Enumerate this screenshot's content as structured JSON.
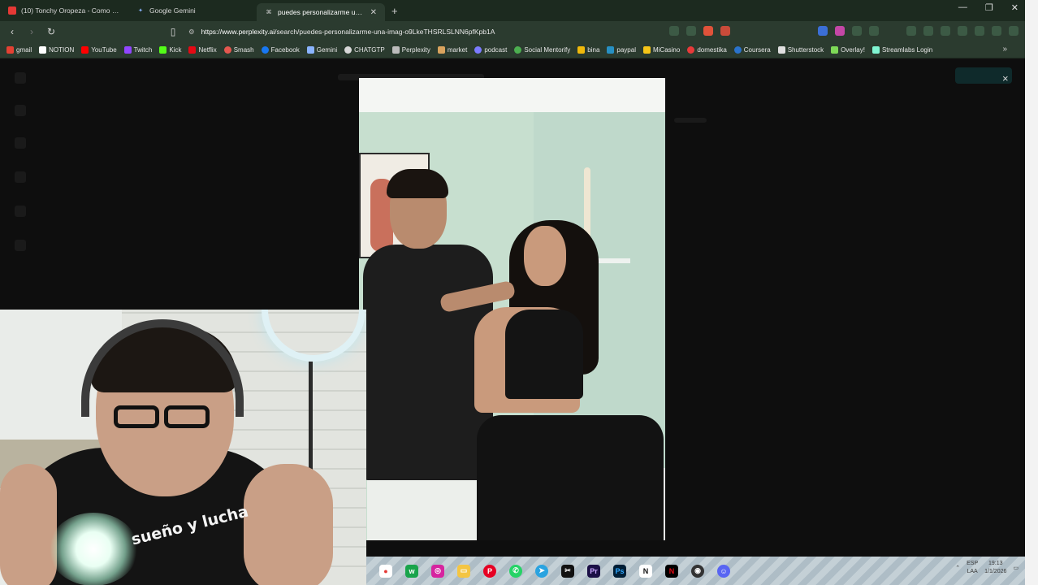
{
  "browser": {
    "tabs": [
      {
        "label": "(10) Tonchy Oropeza - Como cal...",
        "icon": "youtube-icon",
        "active": false
      },
      {
        "label": "Google Gemini",
        "icon": "gemini-icon",
        "active": false
      },
      {
        "label": "puedes personalizarme una imag...",
        "icon": "perplexity-icon",
        "active": true
      }
    ],
    "url": {
      "host": "https://www.perplexity.ai",
      "path": "/search/puedes-personalizarme-una-imag-o9LkeTHSRLSLNN6pfKpb1A"
    },
    "bookmarks": [
      "gmail",
      "NOTION",
      "YouTube",
      "Twitch",
      "Kick",
      "Netflix",
      "Smash",
      "Facebook",
      "Gemini",
      "CHATGTP",
      "Perplexity",
      "market",
      "podcast",
      "Social Mentorify",
      "bina",
      "paypal",
      "MiCasino",
      "domestika",
      "Coursera",
      "Shutterstock",
      "Overlay!",
      "Streamlabs Login"
    ],
    "colors": {
      "tabstrip": "#1c2a1f",
      "toolbar": "#2b3b2f"
    }
  },
  "lightbox": {
    "close_label": "×"
  },
  "webcam": {
    "shirt_text": "sueño y lucha"
  },
  "taskbar": {
    "apps": [
      "chrome-icon",
      "wechat-icon",
      "instagram-icon",
      "files-icon",
      "pinterest-icon",
      "whatsapp-icon",
      "telegram-icon",
      "capcut-icon",
      "premiere-icon",
      "photoshop-icon",
      "notion-icon",
      "netflix-icon",
      "obs-icon",
      "discord-icon"
    ],
    "lang": "ESP",
    "lang_sub": "LAA",
    "time": "19:13",
    "date": "1/1/2026"
  }
}
